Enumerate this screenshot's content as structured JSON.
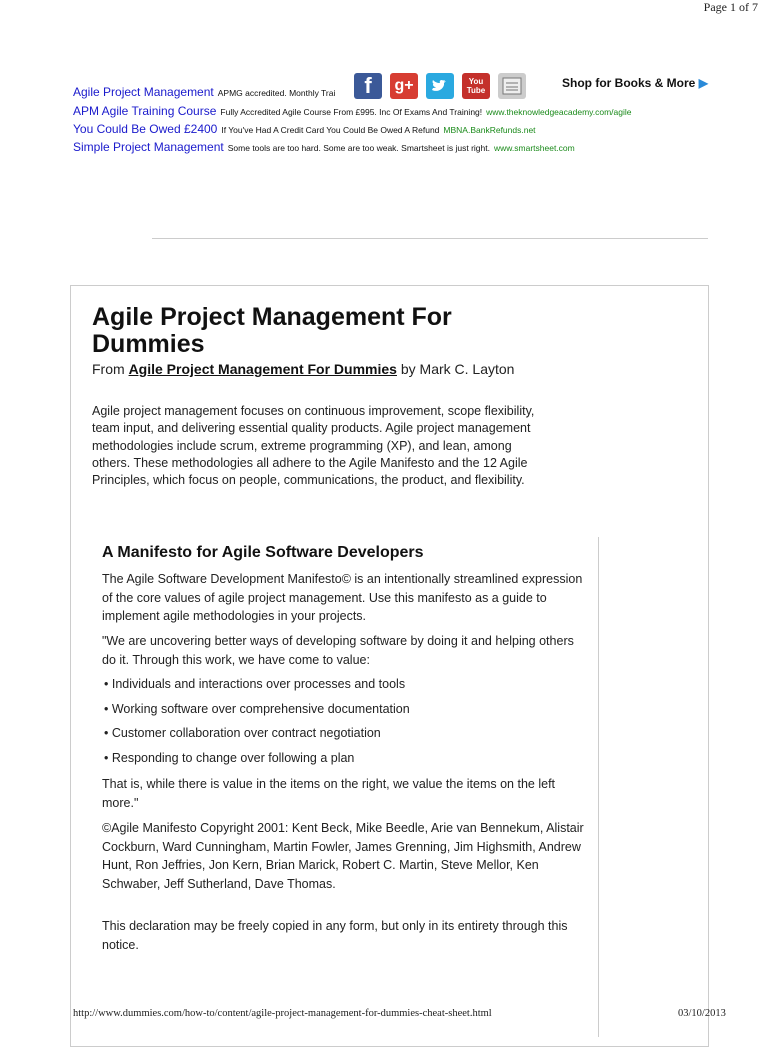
{
  "page_number": "Page 1 of 7",
  "ads": [
    {
      "title": "Agile Project Management",
      "desc": "APMG accredited. Monthly Trai",
      "url": ""
    },
    {
      "title": "APM Agile Training Course",
      "desc": "Fully Accredited Agile Course From £995. Inc Of Exams And Training!",
      "url": "www.theknowledgeacademy.com/agile"
    },
    {
      "title": "You Could Be Owed £2400",
      "desc": "If You've Had A Credit Card You Could Be Owed A Refund",
      "url": "MBNA.BankRefunds.net"
    },
    {
      "title": "Simple Project Management",
      "desc": "Some tools are too hard. Some are too weak. Smartsheet is just right.",
      "url": "www.smartsheet.com"
    }
  ],
  "social": {
    "facebook": "f",
    "googleplus": "g+",
    "youtube": "You Tube",
    "colors": {
      "facebook": "#3b5998",
      "googleplus": "#d73d32",
      "twitter": "#2aa9e0",
      "youtube": "#c4302b"
    }
  },
  "shop": "Shop for Books & More",
  "article": {
    "title": "Agile Project Management For Dummies",
    "from_prefix": "From",
    "book_link": "Agile Project Management For Dummies",
    "by": "by Mark C. Layton",
    "intro": "Agile project management focuses on continuous improvement, scope flexibility, team input, and delivering essential quality products. Agile project management methodologies include scrum, extreme programming (XP), and lean, among others. These methodologies all adhere to the Agile Manifesto and the 12 Agile Principles, which focus on people, communications, the product, and flexibility."
  },
  "section": {
    "title": "A Manifesto for Agile Software Developers",
    "p1": "The Agile Software Development Manifesto© is an intentionally streamlined expression of the core values of agile project management. Use this manifesto as a guide to implement agile methodologies in your projects.",
    "p2": "\"We are uncovering better ways of developing software by doing it and helping others do it. Through this work, we have come to value:",
    "items": [
      "Individuals and interactions over processes and tools",
      "Working software over comprehensive documentation",
      "Customer collaboration over contract negotiation",
      "Responding to change over following a plan"
    ],
    "p3": "That is, while there is value in the items on the right, we value the items on the left more.\"",
    "p4": "©Agile Manifesto Copyright 2001: Kent Beck, Mike Beedle, Arie van Bennekum, Alistair Cockburn, Ward Cunningham, Martin Fowler, James Grenning, Jim Highsmith, Andrew Hunt, Ron Jeffries, Jon Kern, Brian Marick, Robert C. Martin, Steve Mellor, Ken Schwaber, Jeff Sutherland, Dave Thomas.",
    "p5": "This declaration may be freely copied in any form, but only in its entirety through this notice."
  },
  "footer": {
    "url": "http://www.dummies.com/how-to/content/agile-project-management-for-dummies-cheat-sheet.html",
    "date": "03/10/2013"
  }
}
